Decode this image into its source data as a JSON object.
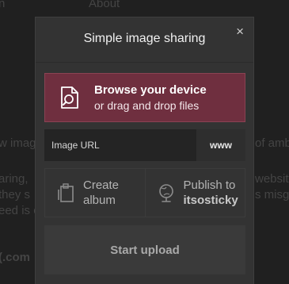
{
  "background": {
    "nav_left": "n",
    "nav_about": "About",
    "left_line_1": "w imag",
    "left_line_2": "aring,",
    "left_line_3": "they s",
    "left_line_4": "eed is c",
    "left_line_5": "(.com",
    "right_line_1": "of amb",
    "right_line_2": "website",
    "right_line_3": "s misg"
  },
  "modal": {
    "title": "Simple image sharing",
    "close_symbol": "×",
    "browse": {
      "line1": "Browse your device",
      "line2": "or drag and drop files",
      "icon": "file-search-icon"
    },
    "url": {
      "placeholder": "Image URL",
      "button_label": "www"
    },
    "actions": {
      "create_album": {
        "line1": "Create",
        "line2": "album",
        "icon": "album-icon"
      },
      "publish": {
        "line1": "Publish to",
        "line2": "itsosticky",
        "icon": "globe-icon"
      }
    },
    "upload_label": "Start upload"
  },
  "colors": {
    "accent": "#6f2f3f",
    "modal_bg": "#333333",
    "page_bg": "#2b2b2b"
  }
}
